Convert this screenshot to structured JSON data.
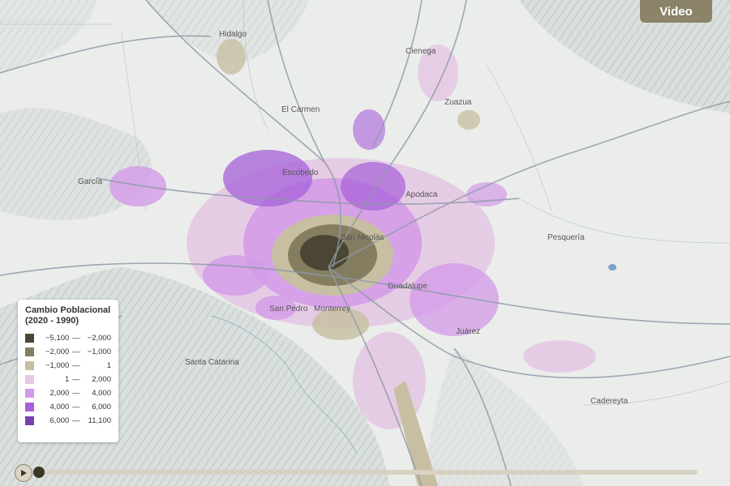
{
  "video_button": {
    "label": "Video"
  },
  "places": [
    {
      "name": "Hidalgo"
    },
    {
      "name": "Cienega"
    },
    {
      "name": "El Carmen"
    },
    {
      "name": "Zuazua"
    },
    {
      "name": "García"
    },
    {
      "name": "Escobedo"
    },
    {
      "name": "Apodaca"
    },
    {
      "name": "San Nicolás"
    },
    {
      "name": "Pesquería"
    },
    {
      "name": "Guadalupe"
    },
    {
      "name": "San Pedro"
    },
    {
      "name": "Monterrey"
    },
    {
      "name": "Juárez"
    },
    {
      "name": "Santa Catarina"
    },
    {
      "name": "Cadereyta"
    }
  ],
  "legend": {
    "title": "Cambio Poblacional (2020 - 1990)",
    "items": [
      {
        "min": "−5,100",
        "sep": "—",
        "max": "−2,000",
        "color": "#4b4633"
      },
      {
        "min": "−2,000",
        "sep": "—",
        "max": "−1,000",
        "color": "#857d60"
      },
      {
        "min": "−1,000",
        "sep": "—",
        "max": "1",
        "color": "#c8bfa2"
      },
      {
        "min": "1",
        "sep": "—",
        "max": "2,000",
        "color": "#e4c8e4"
      },
      {
        "min": "2,000",
        "sep": "—",
        "max": "4,000",
        "color": "#d39ae8"
      },
      {
        "min": "4,000",
        "sep": "—",
        "max": "6,000",
        "color": "#a660d8"
      },
      {
        "min": "6,000",
        "sep": "—",
        "max": "11,100",
        "color": "#7a3fb4"
      }
    ]
  },
  "timeline": {
    "progress": 0.0
  }
}
